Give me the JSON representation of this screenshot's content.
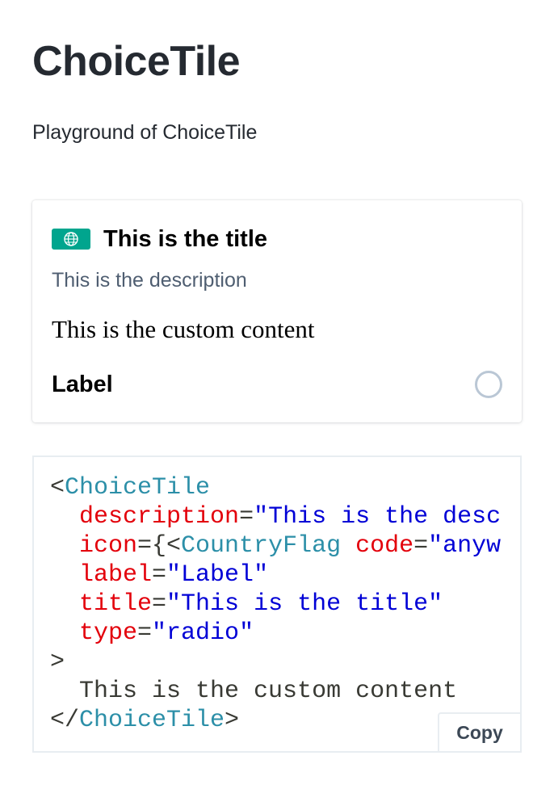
{
  "page": {
    "title": "ChoiceTile",
    "subtitle": "Playground of ChoiceTile"
  },
  "tile": {
    "icon": "globe-flag-icon",
    "icon_color": "#00a58e",
    "title": "This is the title",
    "description": "This is the description",
    "custom_content": "This is the custom content",
    "label": "Label",
    "selected": false
  },
  "code": {
    "open_bracket": "<",
    "component": "ChoiceTile",
    "attr_description": "description",
    "val_description": "\"This is the desc",
    "attr_icon": "icon",
    "icon_open": "={<",
    "icon_component": "CountryFlag",
    "attr_code": "code",
    "val_code": "\"anyw",
    "attr_label": "label",
    "val_label": "\"Label\"",
    "attr_title": "title",
    "val_title": "\"This is the title\"",
    "attr_type": "type",
    "val_type": "\"radio\"",
    "equals": "=",
    "close_bracket": ">",
    "children": "This is the custom content",
    "closing_open": "</",
    "copy_label": "Copy"
  },
  "colors": {
    "tag": "#2c8fa8",
    "attribute": "#e3000b",
    "string": "#0000d6",
    "text": "#393a34"
  }
}
